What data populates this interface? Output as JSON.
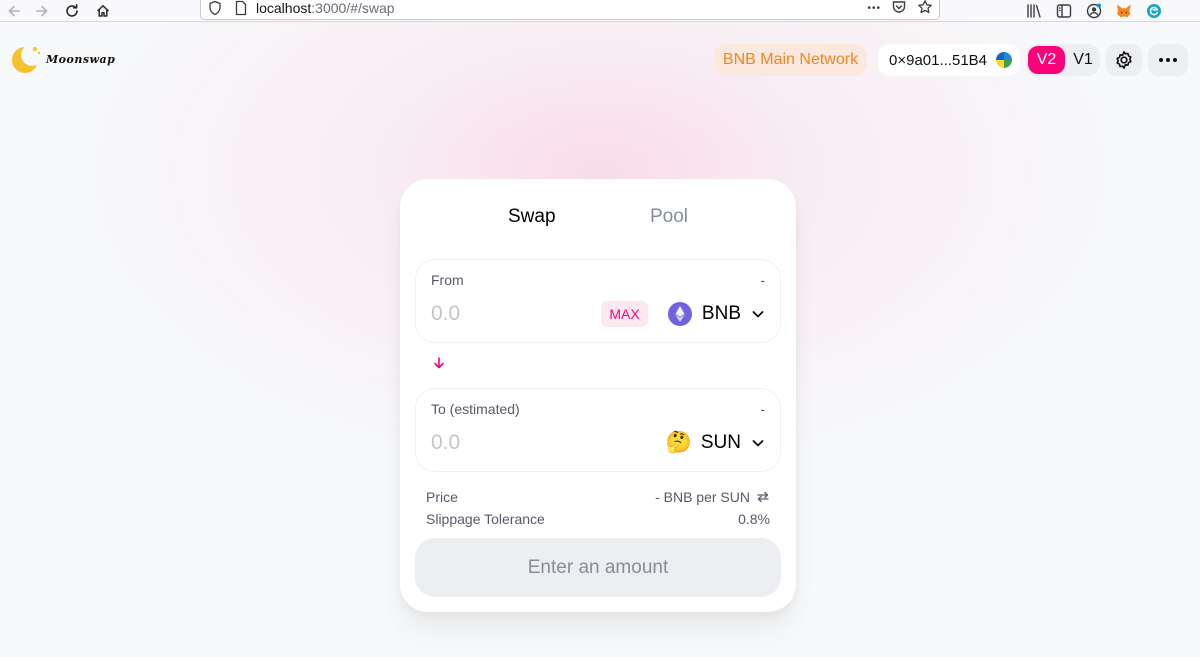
{
  "browser": {
    "url_host": "localhost",
    "url_path": ":3000/#/swap",
    "more_glyph": "•••"
  },
  "header": {
    "logo_text": "Moonswap",
    "network": "BNB Main Network",
    "account": "0×9a01...51B4",
    "version_v2": "V2",
    "version_v1": "V1"
  },
  "card": {
    "tabs": [
      {
        "label": "Swap",
        "active": true
      },
      {
        "label": "Pool",
        "active": false
      }
    ],
    "from": {
      "label": "From",
      "balance": "-",
      "placeholder": "0.0",
      "max_label": "MAX",
      "token": "BNB"
    },
    "to": {
      "label": "To (estimated)",
      "balance": "-",
      "placeholder": "0.0",
      "token": "SUN",
      "token_icon": "🤔"
    },
    "price": {
      "label": "Price",
      "value": "- BNB per SUN"
    },
    "slippage": {
      "label": "Slippage Tolerance",
      "value": "0.8%"
    },
    "submit_label": "Enter an amount"
  },
  "colors": {
    "accent": "#ff007a",
    "network_text": "#f3841e",
    "network_bg": "#fbe8df"
  },
  "icons": [
    "back-arrow-icon",
    "forward-arrow-icon",
    "reload-icon",
    "home-icon",
    "shield-icon",
    "page-icon",
    "bookmark-star-icon",
    "library-icon",
    "sidebar-icon",
    "account-icon",
    "metamask-fox-icon",
    "extension-icon",
    "moon-logo-icon",
    "eth-diamond-icon",
    "chevron-down-icon",
    "arrow-down-icon",
    "swap-arrows-icon",
    "gear-icon",
    "ellipsis-icon"
  ]
}
